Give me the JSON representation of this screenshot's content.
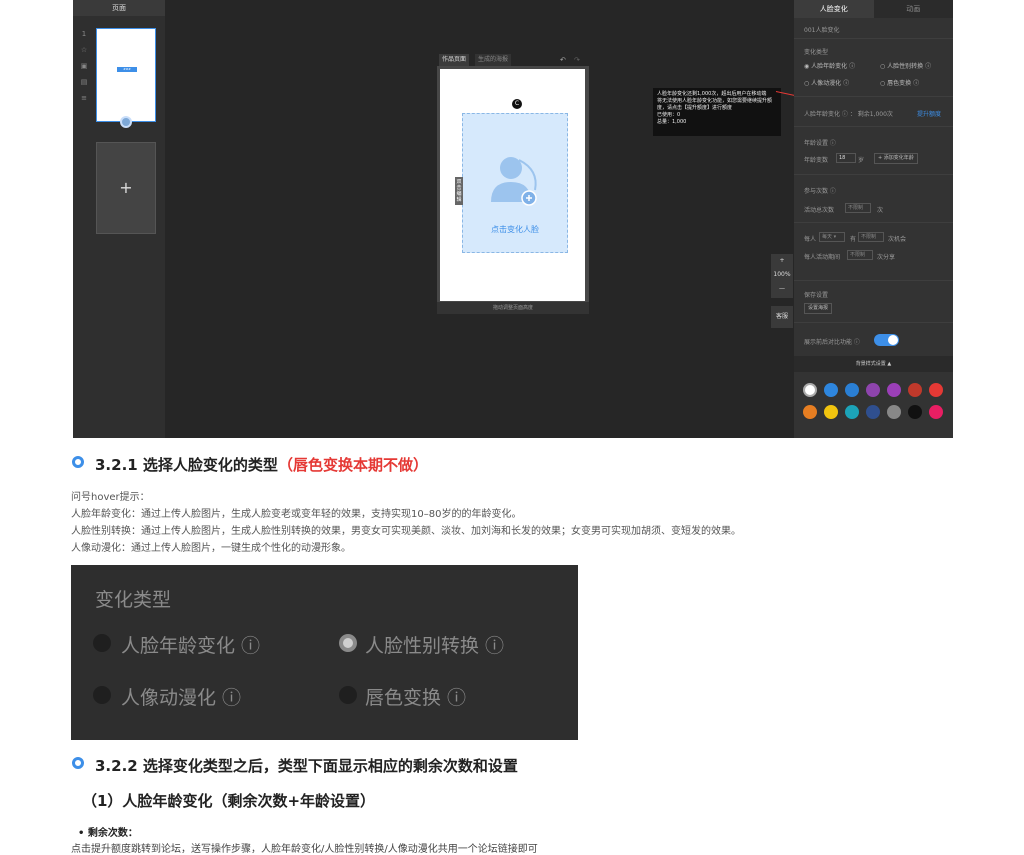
{
  "screenshot": {
    "left_panel": {
      "title": "页面",
      "icons": [
        "1",
        "☆",
        "▣",
        "▤",
        "≡"
      ],
      "thumb_button": "###"
    },
    "canvas": {
      "tab_active": "作品页面",
      "tab_other": "生成的海报",
      "face_handle": "C",
      "face_prompt": "点击变化人脸",
      "side_tag": "双击编辑",
      "footer": "拖动调整页面高度"
    },
    "tooltip": {
      "lines": [
        "人脸年龄变化还剩1,000次，超出后用户在移动端",
        "将无法使用人脸年龄变化功能，如您需要继续提升额",
        "度，请点击【提升额度】进行额度",
        "已使用：0",
        "总量：1,000"
      ]
    },
    "zoom": {
      "plus": "+",
      "level": "100%",
      "minus": "—"
    },
    "kefu": "客服",
    "right_panel": {
      "tab_active": "人脸变化",
      "tab_other": "动画",
      "component_name": "001人脸变化",
      "type_label": "变化类型",
      "options": [
        "人脸年龄变化",
        "人脸性别转换",
        "人像动漫化",
        "唇色变换"
      ],
      "remain_label": "人脸年龄变化",
      "remain_value": "剩余1,000次",
      "raise_link": "提升额度",
      "age_label": "年龄设置",
      "age_change_label": "年龄变数",
      "age_value": "18",
      "age_unit": "岁",
      "add_age_btn": "+ 添加变化年龄",
      "count_label": "参与次数",
      "activity_count_label": "活动总次数",
      "activity_placeholder": "不限制",
      "times_unit": "次",
      "per_person_label": "每人",
      "per_select": "每天",
      "per_has": "有",
      "per_limit": "不限制",
      "per_chance": "次机会",
      "share_label": "每人活动期间",
      "share_limit": "不限制",
      "share_unit": "次分享",
      "save_label": "保存设置",
      "save_btn": "设置海报",
      "compare_label": "展示前后对比功能",
      "bg_bar": "背景样式设置 ▲"
    },
    "swatches": [
      "#ffffff",
      "#2e86de",
      "#2a7fd4",
      "#8e44ad",
      "#9b3fb8",
      "#c0392b",
      "#e53935",
      "#e67e22",
      "#f1c40f",
      "#1ca3b8",
      "#2f4f8f",
      "#888888",
      "#111111",
      "#e91e63"
    ]
  },
  "doc": {
    "s321_title": "3.2.1 选择人脸变化的类型",
    "s321_red": "（唇色变换本期不做）",
    "p1": "问号hover提示：",
    "p2": "人脸年龄变化：通过上传人脸图片，生成人脸变老或变年轻的效果，支持实现10–80岁的的年龄变化。",
    "p3": "人脸性别转换：通过上传人脸图片，生成人脸性别转换的效果，男变女可实现美颜、淡妆、加刘海和长发的效果；女变男可实现加胡须、变短发的效果。",
    "p4": "人像动漫化：通过上传人脸图片，一键生成个性化的动漫形象。",
    "zoom_title": "变化类型",
    "zoom_opts": [
      "人脸年龄变化 ⓘ",
      "人脸性别转换 ⓘ",
      "人像动漫化 ⓘ",
      "唇色变换 ⓘ"
    ],
    "s322_title": "3.2.2 选择变化类型之后，类型下面显示相应的剩余次数和设置",
    "s_sub": "（1）人脸年龄变化（剩余次数+年龄设置）",
    "li_remain": "剩余次数：",
    "cut_text": "点击提升额度跳转到论坛，送写操作步骤，人脸年龄变化/人脸性别转换/人像动漫化共用一个论坛链接即可"
  }
}
